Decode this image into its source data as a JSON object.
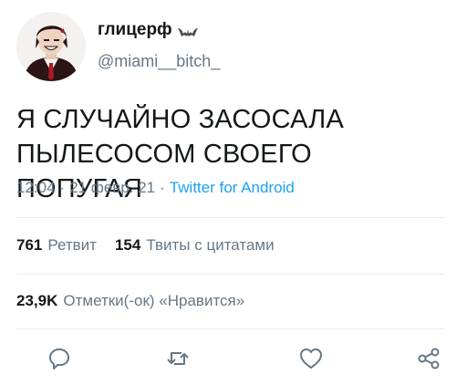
{
  "user": {
    "display_name": "глицерф",
    "handle": "@miami__bitch_",
    "badge_icon": "bat-icon"
  },
  "tweet": {
    "text_line1": "Я СЛУЧАЙНО ЗАСОСАЛА",
    "text_line2": "ПЫЛЕСОСОМ СВОЕГО ПОПУГАЯ",
    "time": "12:04",
    "date": "21 февр. 21",
    "separator": "·",
    "source": "Twitter for Android"
  },
  "stats": {
    "retweets_count": "761",
    "retweets_label": "Ретвит",
    "quotes_count": "154",
    "quotes_label": "Твиты с цитатами",
    "likes_count": "23,9K",
    "likes_label": "Отметки(-ок) «Нравится»"
  },
  "actions": [
    {
      "name": "reply",
      "icon": "reply-icon"
    },
    {
      "name": "retweet",
      "icon": "retweet-icon"
    },
    {
      "name": "like",
      "icon": "heart-icon"
    },
    {
      "name": "share",
      "icon": "share-icon"
    }
  ],
  "colors": {
    "text": "#14171a",
    "secondary": "#657786",
    "link": "#1da1f2",
    "divider": "#e6ecf0"
  }
}
